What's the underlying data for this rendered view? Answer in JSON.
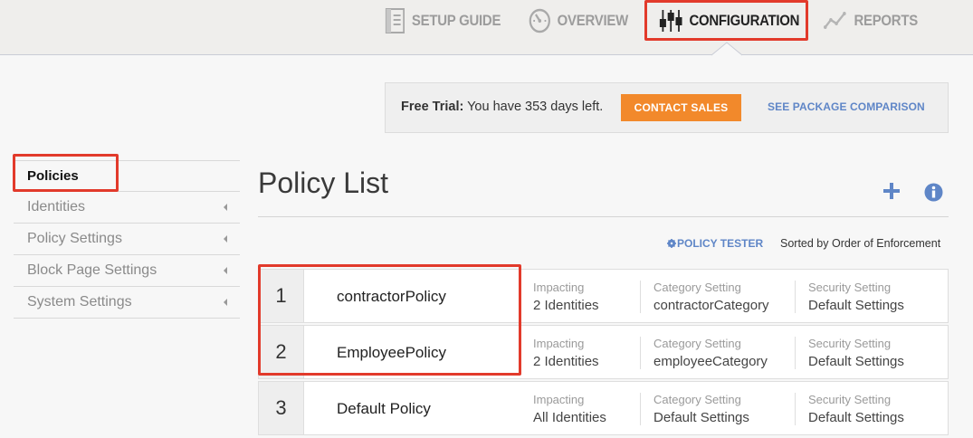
{
  "nav": {
    "items": [
      {
        "label": "SETUP GUIDE",
        "icon": "document-icon",
        "active": false
      },
      {
        "label": "OVERVIEW",
        "icon": "speedometer-icon",
        "active": false
      },
      {
        "label": "CONFIGURATION",
        "icon": "sliders-icon",
        "active": true
      },
      {
        "label": "REPORTS",
        "icon": "line-chart-icon",
        "active": false
      }
    ]
  },
  "trial": {
    "prefix": "Free Trial:",
    "message": " You have 353 days left.",
    "contact_label": "CONTACT SALES",
    "compare_label": "SEE PACKAGE COMPARISON"
  },
  "sidebar": {
    "items": [
      {
        "label": "Policies",
        "active": true
      },
      {
        "label": "Identities",
        "active": false
      },
      {
        "label": "Policy Settings",
        "active": false
      },
      {
        "label": "Block Page Settings",
        "active": false
      },
      {
        "label": "System Settings",
        "active": false
      }
    ]
  },
  "main": {
    "title": "Policy List",
    "policy_tester_label": "POLICY TESTER",
    "sorted_by": "Sorted by Order of Enforcement",
    "column_labels": {
      "impacting": "Impacting",
      "category": "Category Setting",
      "security": "Security Setting"
    },
    "policies": [
      {
        "number": "1",
        "name": "contractorPolicy",
        "impacting": "2 Identities",
        "category": "contractorCategory",
        "security": "Default Settings"
      },
      {
        "number": "2",
        "name": "EmployeePolicy",
        "impacting": "2 Identities",
        "category": "employeeCategory",
        "security": "Default Settings"
      },
      {
        "number": "3",
        "name": "Default Policy",
        "impacting": "All Identities",
        "category": "Default Settings",
        "security": "Default Settings"
      }
    ]
  },
  "colors": {
    "accent_blue": "#5f86c7",
    "highlight_red": "#e23a2b",
    "contact_orange": "#f2892b"
  }
}
